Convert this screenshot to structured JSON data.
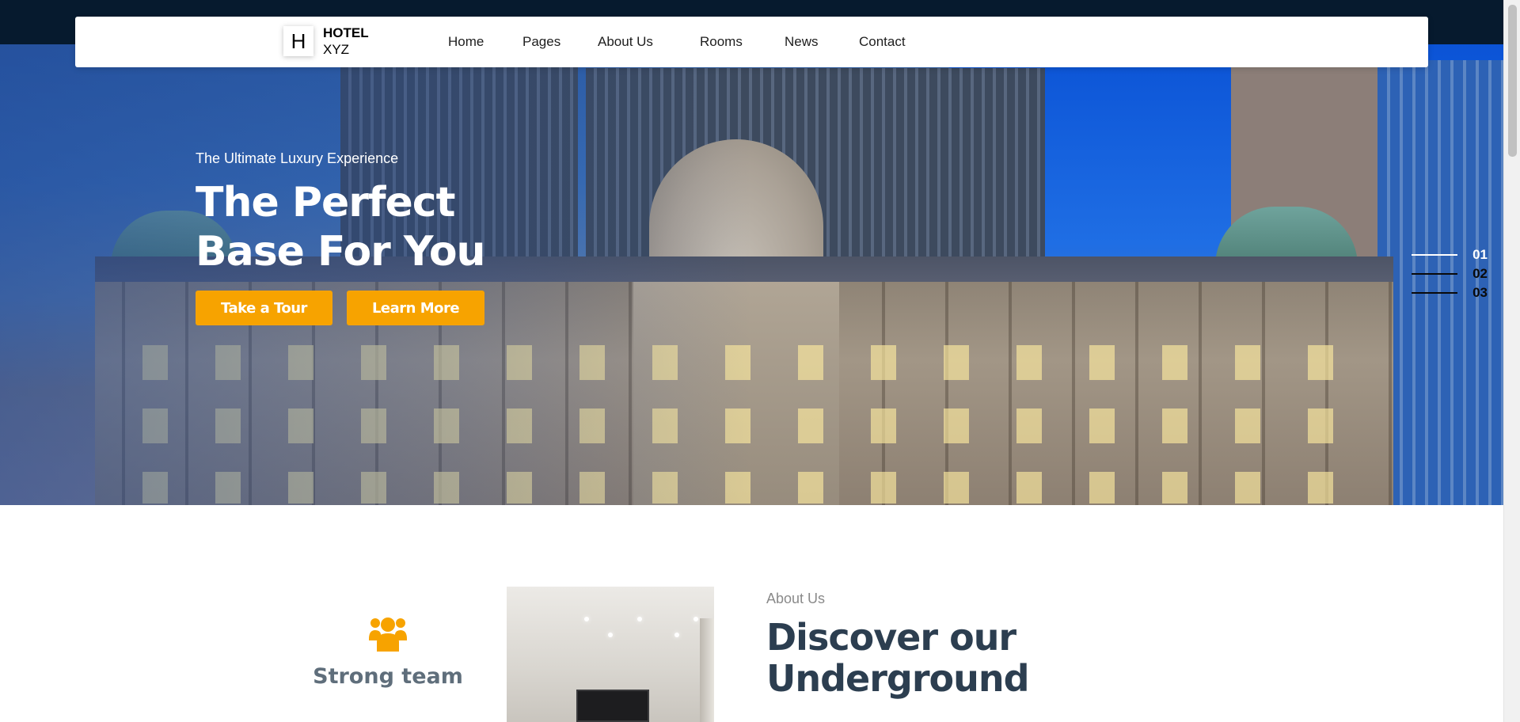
{
  "brand": {
    "badge": "H",
    "line1": "HOTEL",
    "line2": "XYZ"
  },
  "nav": {
    "items": [
      {
        "label": "Home"
      },
      {
        "label": "Pages"
      },
      {
        "label": "About Us"
      },
      {
        "label": "Rooms"
      },
      {
        "label": "News"
      },
      {
        "label": "Contact"
      }
    ]
  },
  "hero": {
    "tagline": "The Ultimate Luxury Experience",
    "title_line1": "The Perfect",
    "title_line2": "Base For You",
    "primary_button": "Take a Tour",
    "secondary_button": "Learn More"
  },
  "slides": {
    "items": [
      {
        "number": "01",
        "active": true
      },
      {
        "number": "02",
        "active": false
      },
      {
        "number": "03",
        "active": false
      }
    ]
  },
  "feature": {
    "icon": "users-icon",
    "title": "Strong team"
  },
  "about": {
    "label": "About Us",
    "heading_line1": "Discover our",
    "heading_line2": "Underground"
  },
  "colors": {
    "accent": "#f7a300",
    "top_strip": "#061a2e",
    "heading": "#2c3e50",
    "feature_title": "#5f6e7b"
  }
}
